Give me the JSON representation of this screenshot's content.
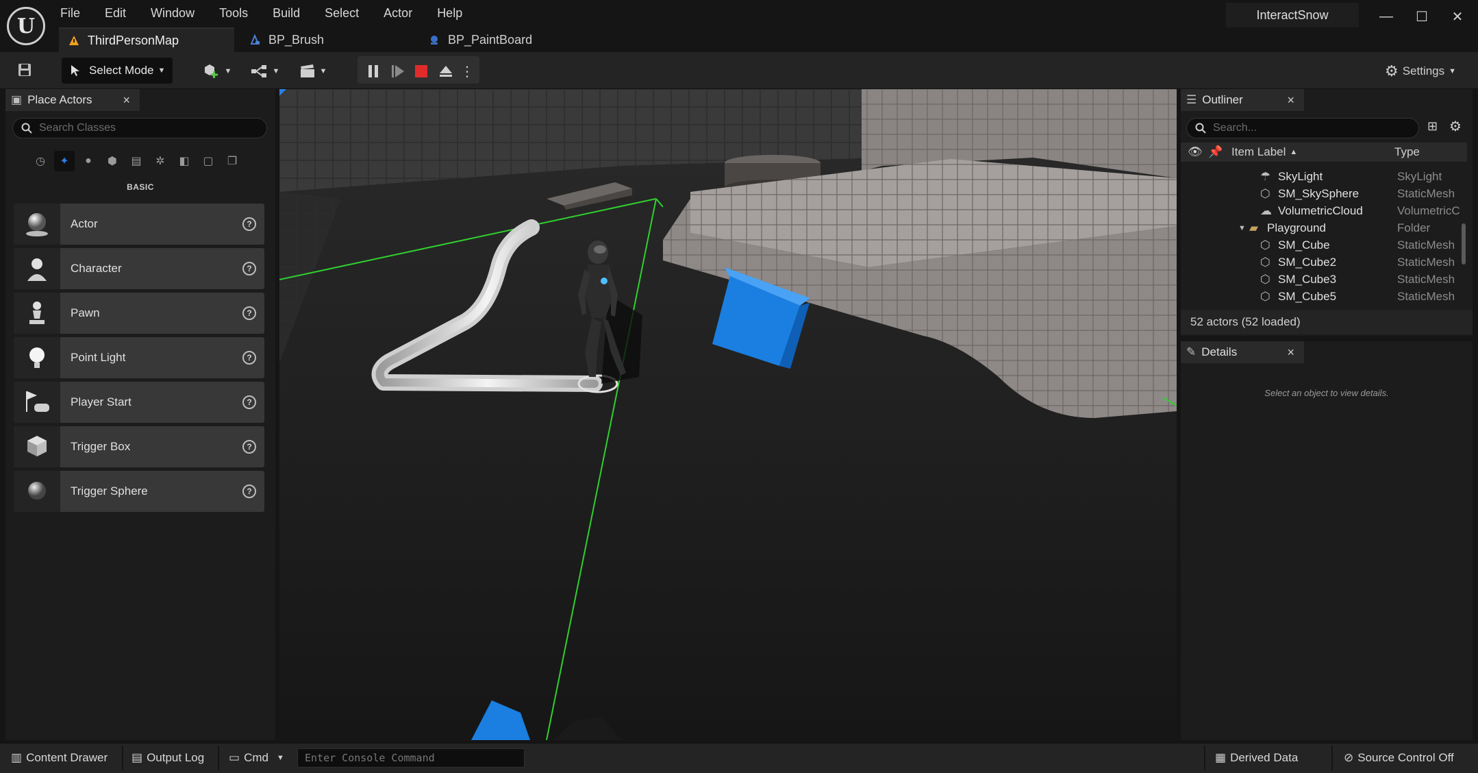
{
  "app": {
    "menu": [
      "File",
      "Edit",
      "Window",
      "Tools",
      "Build",
      "Select",
      "Actor",
      "Help"
    ],
    "project_name": "InteractSnow",
    "window_controls": {
      "minimize": "—",
      "maximize": "☐",
      "close": "✕"
    }
  },
  "tabs": [
    {
      "label": "ThirdPersonMap",
      "icon": "level-icon",
      "active": true
    },
    {
      "label": "BP_Brush",
      "icon": "blueprint-icon",
      "active": false
    },
    {
      "label": "BP_PaintBoard",
      "icon": "blueprint-icon",
      "active": false
    }
  ],
  "toolbar": {
    "select_mode_label": "Select Mode",
    "settings_label": "Settings"
  },
  "place_actors": {
    "tab_label": "Place Actors",
    "search_placeholder": "Search Classes",
    "category_label": "BASIC",
    "items": [
      {
        "label": "Actor",
        "icon": "sphere-icon"
      },
      {
        "label": "Character",
        "icon": "character-icon"
      },
      {
        "label": "Pawn",
        "icon": "pawn-icon"
      },
      {
        "label": "Point Light",
        "icon": "point-light-icon"
      },
      {
        "label": "Player Start",
        "icon": "player-start-icon"
      },
      {
        "label": "Trigger Box",
        "icon": "trigger-box-icon"
      },
      {
        "label": "Trigger Sphere",
        "icon": "trigger-sphere-icon"
      }
    ]
  },
  "outliner": {
    "tab_label": "Outliner",
    "search_placeholder": "Search...",
    "col_label": "Item Label",
    "col_type": "Type",
    "rows": [
      {
        "label": "SkyLight",
        "type": "SkyLight",
        "icon": "skylight-icon"
      },
      {
        "label": "SM_SkySphere",
        "type": "StaticMesh",
        "icon": "static-mesh-icon"
      },
      {
        "label": "VolumetricCloud",
        "type": "VolumetricC",
        "icon": "cloud-icon"
      },
      {
        "label": "Playground",
        "type": "Folder",
        "icon": "folder-icon"
      },
      {
        "label": "SM_Cube",
        "type": "StaticMesh",
        "icon": "static-mesh-icon"
      },
      {
        "label": "SM_Cube2",
        "type": "StaticMesh",
        "icon": "static-mesh-icon"
      },
      {
        "label": "SM_Cube3",
        "type": "StaticMesh",
        "icon": "static-mesh-icon"
      },
      {
        "label": "SM_Cube5",
        "type": "StaticMesh",
        "icon": "static-mesh-icon"
      }
    ],
    "actor_count": "52 actors (52 loaded)"
  },
  "details": {
    "tab_label": "Details",
    "hint": "Select an object to view details."
  },
  "statusbar": {
    "content_drawer": "Content Drawer",
    "output_log": "Output Log",
    "cmd": "Cmd",
    "console_placeholder": "Enter Console Command",
    "derived_data": "Derived Data",
    "source_control": "Source Control Off"
  },
  "colors": {
    "accent": "#2a7fe6",
    "stop_red": "#e02b2b",
    "cube_blue": "#1a7fe0",
    "selection_green": "#2fd02f"
  }
}
